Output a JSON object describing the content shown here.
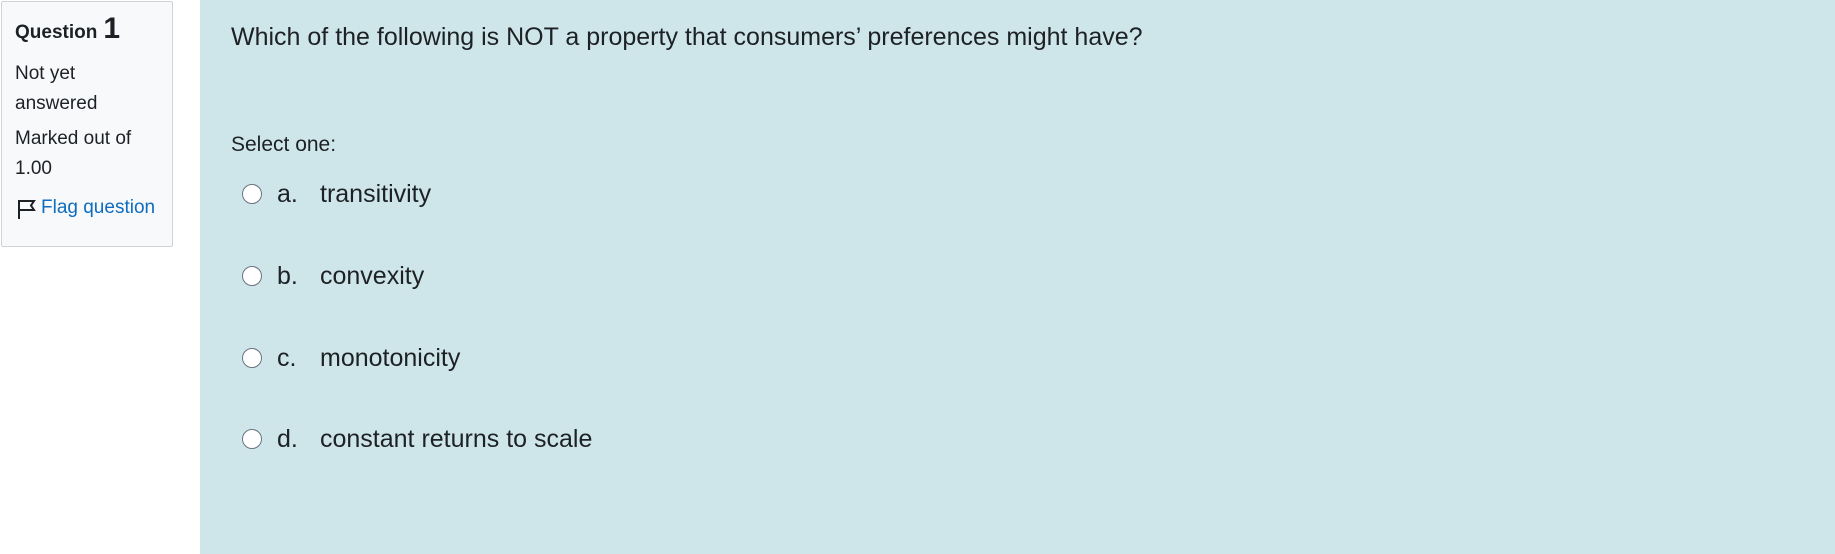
{
  "info": {
    "question_label": "Question",
    "question_number": "1",
    "state": "Not yet answered",
    "grade": "Marked out of 1.00",
    "flag_label": "Flag question"
  },
  "question": {
    "text": "Which of the following is NOT a property that consumers’ preferences might have?",
    "prompt": "Select one:",
    "options": [
      {
        "letter": "a.",
        "label": "transitivity"
      },
      {
        "letter": "b.",
        "label": "convexity"
      },
      {
        "letter": "c.",
        "label": "monotonicity"
      },
      {
        "letter": "d.",
        "label": "constant returns to scale"
      }
    ]
  },
  "colors": {
    "panel_background": "#cee6ea",
    "info_background": "#f8f9fa",
    "link": "#0f6cbf"
  }
}
